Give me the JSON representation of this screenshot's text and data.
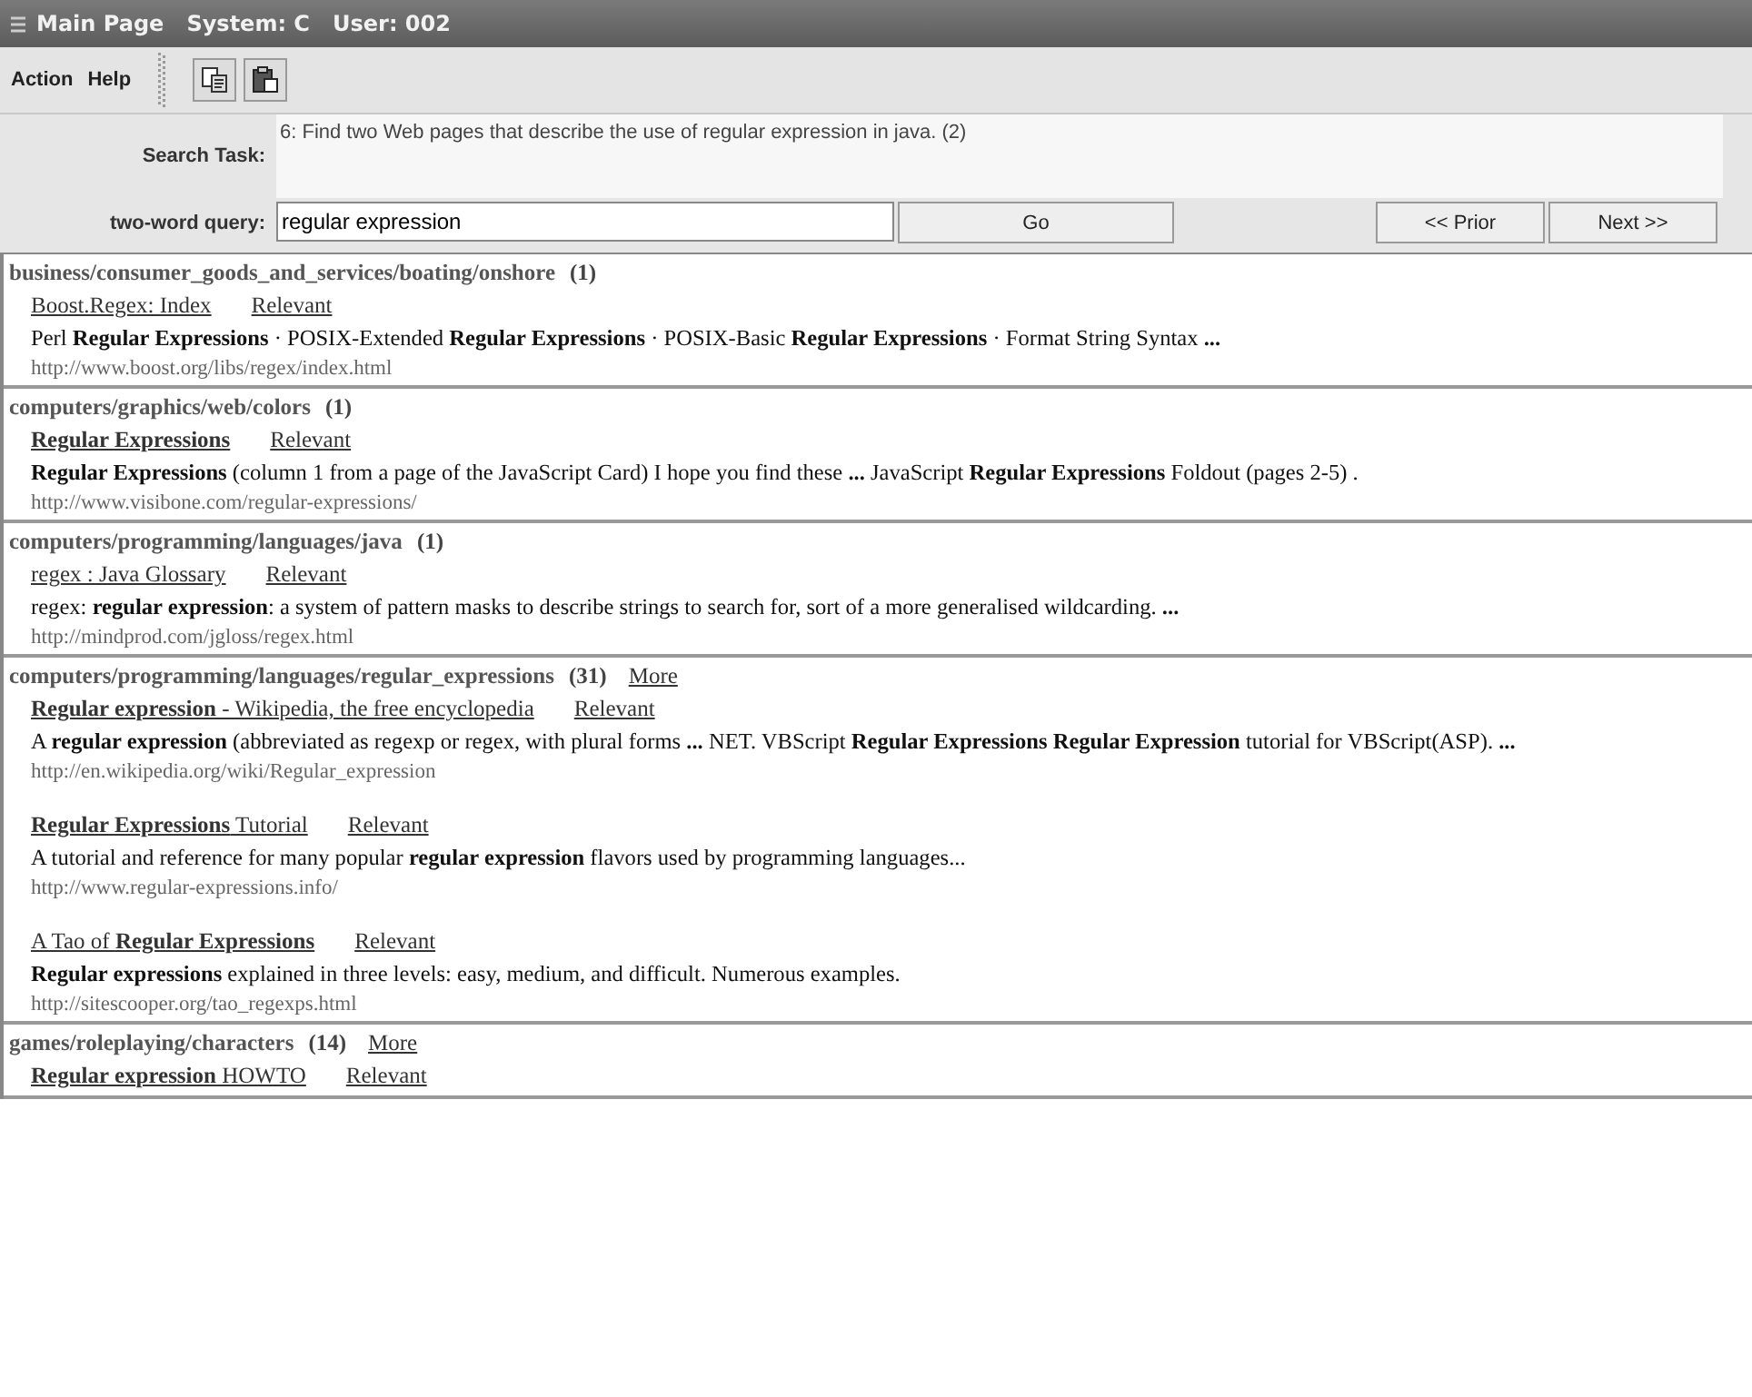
{
  "window": {
    "title": "Main Page   System: C   User: 002"
  },
  "menu": [
    "Action",
    "Help"
  ],
  "task": {
    "label": "Search Task:",
    "text": "6: Find two Web pages that describe the use of regular expression in java. (2)"
  },
  "query": {
    "label": "two-word query:",
    "value": "regular expression",
    "go": "Go",
    "prior": "<< Prior",
    "next": "Next >>"
  },
  "categories": [
    {
      "path": "business/consumer_goods_and_services/boating/onshore",
      "count": "(1)",
      "results": [
        {
          "title": "Boost.Regex: Index",
          "relevant": "Relevant",
          "snippet": "Perl **Regular Expressions** · POSIX-Extended **Regular Expressions** · POSIX-Basic **Regular Expressions** · Format String Syntax **...**",
          "url": "http://www.boost.org/libs/regex/index.html"
        }
      ]
    },
    {
      "path": "computers/graphics/web/colors",
      "count": "(1)",
      "results": [
        {
          "title": "**Regular Expressions**",
          "relevant": "Relevant",
          "snippet": "**Regular Expressions** (column 1 from a page of the JavaScript Card) I hope you find these **...** JavaScript **Regular Expressions** Foldout (pages 2-5) .",
          "url": "http://www.visibone.com/regular-expressions/"
        }
      ]
    },
    {
      "path": "computers/programming/languages/java",
      "count": "(1)",
      "results": [
        {
          "title": "regex : Java Glossary",
          "relevant": "Relevant",
          "snippet": "regex: **regular expression**: a system of pattern masks to describe strings to search for, sort of a more generalised wildcarding. **...**",
          "url": "http://mindprod.com/jgloss/regex.html"
        }
      ]
    },
    {
      "path": "computers/programming/languages/regular_expressions",
      "count": "(31)",
      "more": "More",
      "results": [
        {
          "title": "**Regular expression** - Wikipedia, the free encyclopedia",
          "relevant": "Relevant",
          "snippet": "A **regular expression** (abbreviated as regexp or regex, with plural forms **...** NET. VBScript **Regular Expressions Regular Expression** tutorial for VBScript(ASP). **...**",
          "url": "http://en.wikipedia.org/wiki/Regular_expression"
        },
        {
          "title": "**Regular Expressions** Tutorial",
          "relevant": "Relevant",
          "snippet": "A tutorial and reference for many popular **regular expression** flavors used by programming languages...",
          "url": "http://www.regular-expressions.info/"
        },
        {
          "title": "A Tao of **Regular Expressions**",
          "relevant": "Relevant",
          "snippet": "**Regular expressions** explained in three levels: easy, medium, and difficult. Numerous examples.",
          "url": "http://sitescooper.org/tao_regexps.html"
        }
      ]
    },
    {
      "path": "games/roleplaying/characters",
      "count": "(14)",
      "more": "More",
      "results": [
        {
          "title": "**Regular expression** HOWTO",
          "relevant": "Relevant"
        }
      ]
    }
  ]
}
